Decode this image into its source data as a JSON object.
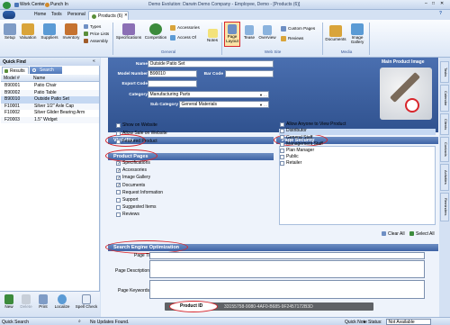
{
  "title_bar": {
    "work_center": "Work Center",
    "punch_in": "Punch In",
    "window_title": "Demo Evolution: Darwin Demo Company - Employee, Demo - [Products (6)]"
  },
  "menu": {
    "home": "Home",
    "tools": "Tools",
    "personal": "Personal",
    "products_tab": "Products (6)"
  },
  "ribbon": {
    "setup": "Setup",
    "valuation": "Valuation",
    "suppliers": "Suppliers",
    "inventory": "Inventory",
    "types": "Types",
    "price_lists": "Price Lists",
    "assembly": "Assembly",
    "specifications": "Specifications",
    "competition": "Competition",
    "accessories": "Accessories",
    "access_of": "Access Of",
    "notes": "Notes",
    "page_layout": "Page Layout",
    "tease": "Tease",
    "overview": "Overview",
    "custom_pages": "Custom Pages",
    "reviews": "Reviews",
    "documents": "Documents",
    "image_gallery": "Image Gallery",
    "group_general": "General",
    "group_web_site": "Web Site",
    "group_media": "Media"
  },
  "quick_find": {
    "title": "Quick Find",
    "tab_results": "Results",
    "tab_search": "Search",
    "col_model": "Model #",
    "col_name": "Name",
    "rows": [
      {
        "model": "B90001",
        "name": "Patio Chair"
      },
      {
        "model": "B90002",
        "name": "Patio Table"
      },
      {
        "model": "B90010",
        "name": "Outside Patio Set"
      },
      {
        "model": "F10001",
        "name": "Silver 1/2\" Axle Cap"
      },
      {
        "model": "F10002",
        "name": "Silver Glider Bearing Arm"
      },
      {
        "model": "F20003",
        "name": "1.5\" Widget"
      }
    ]
  },
  "bottom_toolbar": {
    "new": "New",
    "delete": "Delete",
    "print": "Print",
    "localize": "Localize",
    "spell_check": "Spell Check"
  },
  "form": {
    "name_label": "Name",
    "name_value": "Outside Patio Set",
    "model_label": "Model Number",
    "model_value": "B90010",
    "bar_code_label": "Bar Code",
    "bar_code_value": "",
    "export_label": "Export Code",
    "export_value": "",
    "category_label": "Category",
    "category_value": "Manufacturing Parts",
    "sub_category_label": "Sub Category",
    "sub_category_value": "General Materials",
    "main_image_label": "Main Product Image"
  },
  "visibility": {
    "title": "Visibility",
    "items": [
      {
        "label": "Show on Website",
        "checked": false
      },
      {
        "label": "Allow Sale on Website",
        "checked": false
      },
      {
        "label": "Featured Product",
        "checked": false
      }
    ]
  },
  "page_security": {
    "title": "Page Security",
    "items": [
      {
        "label": "Allow Anyone to View Product",
        "checked": false
      },
      {
        "label": "Distributor",
        "checked": false
      },
      {
        "label": "General Staff",
        "checked": false
      },
      {
        "label": "Management Staff",
        "checked": false
      },
      {
        "label": "Plan Manager",
        "checked": false
      },
      {
        "label": "Public",
        "checked": false
      },
      {
        "label": "Retailer",
        "checked": false
      }
    ],
    "clear_all": "Clear All",
    "select_all": "Select All"
  },
  "product_pages": {
    "title": "Product Pages",
    "items": [
      {
        "label": "Specifications",
        "checked": true
      },
      {
        "label": "Accessories",
        "checked": true
      },
      {
        "label": "Image Gallery",
        "checked": true
      },
      {
        "label": "Documents",
        "checked": true
      },
      {
        "label": "Request Information",
        "checked": false
      },
      {
        "label": "Support",
        "checked": false
      },
      {
        "label": "Suggested Items",
        "checked": false
      },
      {
        "label": "Reviews",
        "checked": false
      }
    ]
  },
  "seo": {
    "title": "Search Engine Optimization",
    "page_title_label": "Page Title",
    "page_description_label": "Page Description",
    "page_keywords_label": "Page Keywords"
  },
  "product_id": {
    "label": "Product ID",
    "value": "33155758-9080-4AF0-B685-9F2457172B3D"
  },
  "side_tabs": [
    "Tasks",
    "Calendar",
    "Clients",
    "Contacts",
    "Activities",
    "Reminders"
  ],
  "status_bar": {
    "quick_search": "Quick Search",
    "status": "No Updates Found.",
    "quick_note": "Quick Note",
    "status_label": "Status:",
    "status_value": "Not Available"
  },
  "colors": {
    "accent": "#3e63a5",
    "ellipse": "#d8262c",
    "background": "#d4e1f3"
  }
}
